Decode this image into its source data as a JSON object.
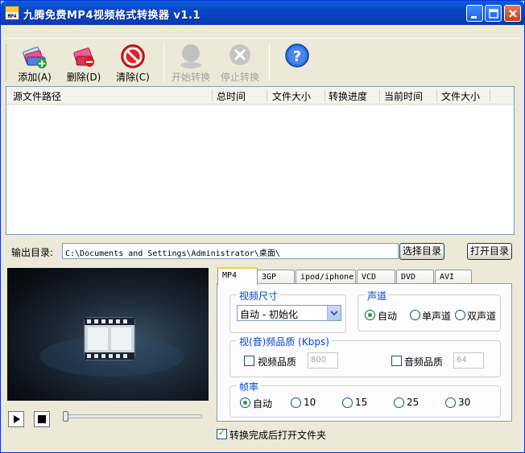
{
  "window": {
    "title": "九腾免费MP4视频格式转换器 v1.1",
    "app_icon_text": "MP4"
  },
  "toolbar": {
    "add_label": "添加(A)",
    "delete_label": "删除(D)",
    "clear_label": "清除(C)",
    "start_label": "开始转换",
    "stop_label": "停止转换"
  },
  "file_list": {
    "columns": [
      "源文件路径",
      "总时间",
      "文件大小",
      "转换进度",
      "当前时间",
      "文件大小"
    ],
    "rows": []
  },
  "output": {
    "label": "输出目录:",
    "path": "C:\\Documents and Settings\\Administrator\\桌面\\",
    "choose_button": "选择目录",
    "open_button": "打开目录"
  },
  "tabs": [
    "MP4",
    "3GP",
    "ipod/iphone",
    "VCD",
    "DVD",
    "AVI"
  ],
  "active_tab": "MP4",
  "settings": {
    "video_size": {
      "title": "视频尺寸",
      "selected": "自动 - 初始化"
    },
    "channel": {
      "title": "声道",
      "options": [
        "自动",
        "单声道",
        "双声道"
      ],
      "selected": "自动"
    },
    "quality": {
      "title": "视(音)频品质 (Kbps)",
      "video_label": "视频品质",
      "video_value": "800",
      "video_checked": false,
      "audio_label": "音频品质",
      "audio_value": "64",
      "audio_checked": false
    },
    "framerate": {
      "title": "帧率",
      "options": [
        "自动",
        "10",
        "15",
        "25",
        "30"
      ],
      "selected": "自动"
    }
  },
  "open_after": {
    "label": "转换完成后打开文件夹",
    "checked": true
  },
  "player": {
    "progress": 0
  },
  "colors": {
    "titlebar": "#0a5fd8",
    "window_bg": "#ece9d8",
    "group_title": "#0046d5",
    "radio_dot": "#21a121"
  }
}
